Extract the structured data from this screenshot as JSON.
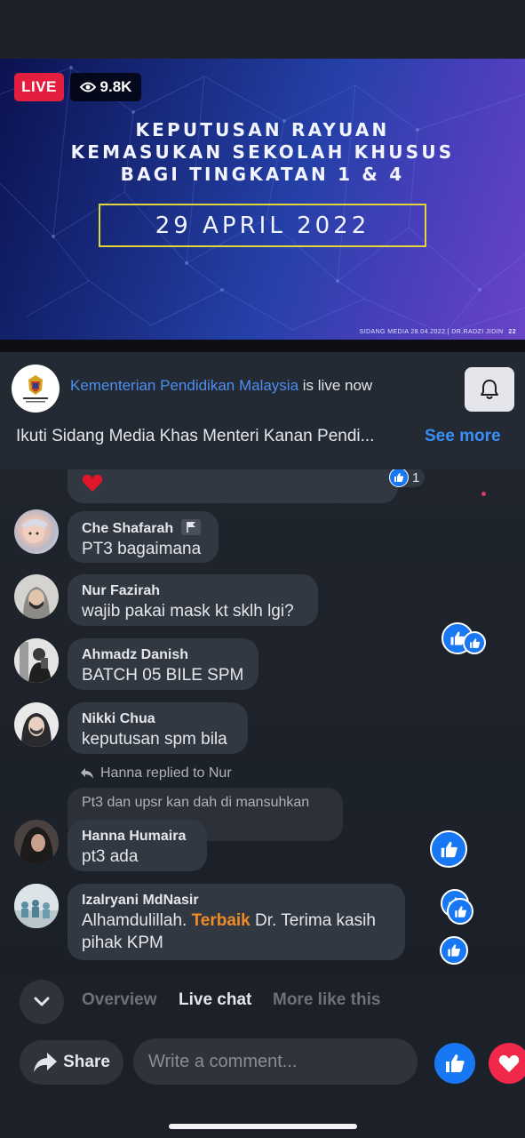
{
  "video": {
    "live_label": "LIVE",
    "viewers": "9.8K",
    "title_lines": [
      "KEPUTUSAN RAYUAN",
      "KEMASUKAN SEKOLAH KHUSUS",
      "BAGI TINGKATAN 1 & 4"
    ],
    "date": "29 APRIL 2022",
    "footer": "SIDANG MEDIA 28.04.2022 | DR.RADZI JIDIN",
    "slide_number": "22"
  },
  "page": {
    "name": "Kementerian Pendidikan Malaysia",
    "live_status": " is live now",
    "description": "Ikuti Sidang Media Khas Menteri Kanan Pendi...",
    "see_more": "See more"
  },
  "chat": {
    "top_reaction_count": "1",
    "messages": [
      {
        "name": "Che Shafarah",
        "text": "PT3 bagaimana"
      },
      {
        "name": "Nur Fazirah",
        "text": "wajib pakai mask kt sklh lgi?"
      },
      {
        "name": "Ahmadz Danish",
        "text": "BATCH 05 BILE SPM"
      },
      {
        "name": "Nikki Chua",
        "text": "keputusan spm bila"
      },
      {
        "name": "Hanna Humaira",
        "text": "pt3 ada"
      },
      {
        "name": "Izalryani MdNasir",
        "text_before": "Alhamdulillah. ",
        "highlight": "Terbaik",
        "text_after": " Dr. Terima kasih",
        "text_line2": "pihak KPM"
      }
    ],
    "reply_note": "Hanna replied to Nur",
    "quoted_text": "Pt3 dan upsr kan dah di mansuhkan"
  },
  "tabs": {
    "items": [
      "Overview",
      "Live chat",
      "More like this"
    ],
    "active": "Live chat"
  },
  "bottom": {
    "share_label": "Share",
    "comment_placeholder": "Write a comment..."
  },
  "colors": {
    "live": "#e41e3f",
    "link": "#4d8ef0",
    "like": "#1877f2",
    "love": "#f0284a",
    "highlight": "#f08c25"
  }
}
